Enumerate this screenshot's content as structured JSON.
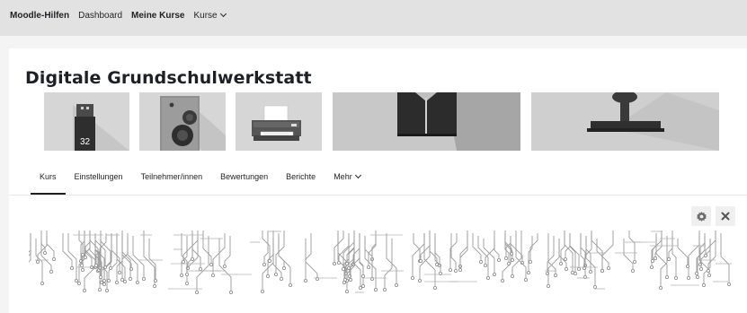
{
  "topnav": {
    "brand": "Moodle-Hilfen",
    "items": [
      "Dashboard",
      "Meine Kurse",
      "Kurse"
    ]
  },
  "course": {
    "title": "Digitale Grundschulwerkstatt"
  },
  "banners": [
    {
      "icon": "usb-stick-icon",
      "text": "32"
    },
    {
      "icon": "speaker-icon"
    },
    {
      "icon": "printer-icon"
    },
    {
      "icon": "cable-icon"
    },
    {
      "icon": "joystick-icon"
    }
  ],
  "tabs": [
    "Kurs",
    "Einstellungen",
    "Teilnehmer/innen",
    "Bewertungen",
    "Berichte",
    "Mehr"
  ],
  "controls": {
    "settings_icon": "gear-icon",
    "close_icon": "close-icon"
  },
  "colors": {
    "topbar": "#e2e2e2",
    "background": "#f4f4f4",
    "card": "#ffffff",
    "text": "#1d2125"
  }
}
